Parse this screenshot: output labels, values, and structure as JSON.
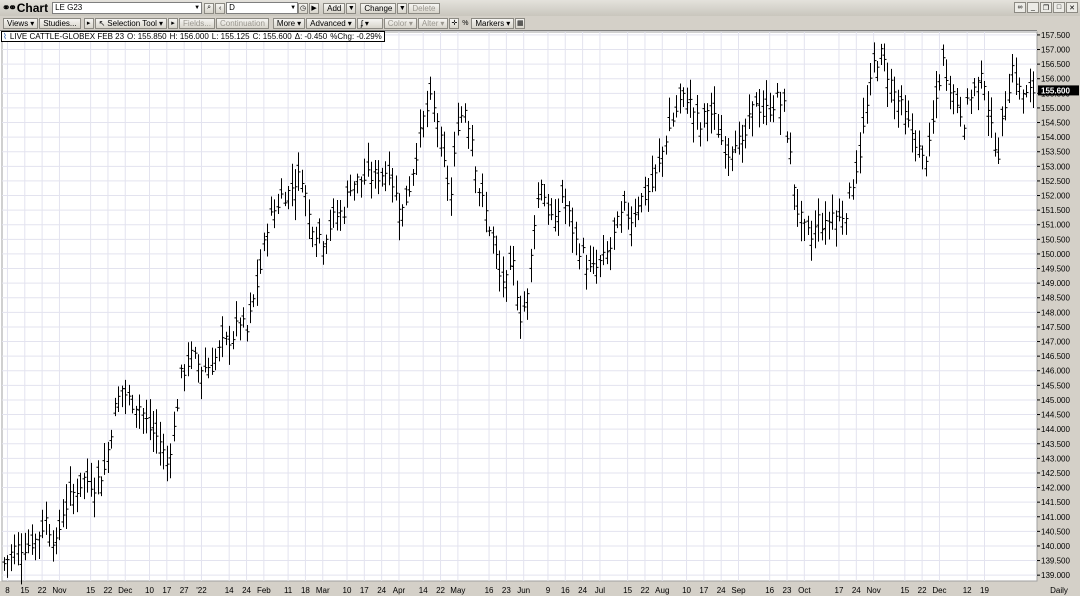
{
  "window": {
    "title": "Chart",
    "symbol": "LE G23",
    "interval": "D",
    "add_label": "Add",
    "change_label": "Change",
    "delete_label": "Delete"
  },
  "toolbar": {
    "views": "Views",
    "studies": "Studies...",
    "selection_tool": "Selection Tool",
    "fields": "Fields...",
    "continuation": "Continuation",
    "more": "More",
    "advanced": "Advanced",
    "color": "Color",
    "alter": "Alter",
    "percent": "%",
    "markers": "Markers"
  },
  "info": {
    "instrument": "LIVE CATTLE-GLOBEX FEB 23",
    "open": "O: 155.850",
    "high": "H: 156.000",
    "low": "L: 155.125",
    "close": "C: 155.600",
    "change": "Δ: -0.450",
    "pct_change": "%Chg: -0.29%"
  },
  "colors": {
    "bars": "#000000",
    "grid": "#e3e3ef",
    "background": "#ffffff",
    "frame": "#d4d0c8",
    "last_price_bg": "#000000"
  },
  "chart_data": {
    "type": "ohlc",
    "ylim": [
      138.8,
      157.6
    ],
    "yticks": [
      "157.500",
      "157.000",
      "156.500",
      "156.000",
      "155.500",
      "155.000",
      "154.500",
      "154.000",
      "153.500",
      "153.000",
      "152.500",
      "152.000",
      "151.500",
      "151.000",
      "150.500",
      "150.000",
      "149.500",
      "149.000",
      "148.500",
      "148.000",
      "147.500",
      "147.000",
      "146.500",
      "146.000",
      "145.500",
      "145.000",
      "144.500",
      "144.000",
      "143.500",
      "143.000",
      "142.500",
      "142.000",
      "141.500",
      "141.000",
      "140.500",
      "140.000",
      "139.500",
      "139.000"
    ],
    "last_price": "155.600",
    "interval_label": "Daily",
    "xlabels": [
      {
        "label": "8",
        "i": 1
      },
      {
        "label": "15",
        "i": 6
      },
      {
        "label": "22",
        "i": 11
      },
      {
        "label": "Nov",
        "i": 16
      },
      {
        "label": "15",
        "i": 25
      },
      {
        "label": "22",
        "i": 30
      },
      {
        "label": "Dec",
        "i": 35
      },
      {
        "label": "10",
        "i": 42
      },
      {
        "label": "17",
        "i": 47
      },
      {
        "label": "27",
        "i": 52
      },
      {
        "label": "'22",
        "i": 57
      },
      {
        "label": "14",
        "i": 65
      },
      {
        "label": "24",
        "i": 70
      },
      {
        "label": "Feb",
        "i": 75
      },
      {
        "label": "11",
        "i": 82
      },
      {
        "label": "18",
        "i": 87
      },
      {
        "label": "Mar",
        "i": 92
      },
      {
        "label": "10",
        "i": 99
      },
      {
        "label": "17",
        "i": 104
      },
      {
        "label": "24",
        "i": 109
      },
      {
        "label": "Apr",
        "i": 114
      },
      {
        "label": "14",
        "i": 121
      },
      {
        "label": "22",
        "i": 126
      },
      {
        "label": "May",
        "i": 131
      },
      {
        "label": "16",
        "i": 140
      },
      {
        "label": "23",
        "i": 145
      },
      {
        "label": "Jun",
        "i": 150
      },
      {
        "label": "9",
        "i": 157
      },
      {
        "label": "16",
        "i": 162
      },
      {
        "label": "24",
        "i": 167
      },
      {
        "label": "Jul",
        "i": 172
      },
      {
        "label": "15",
        "i": 180
      },
      {
        "label": "22",
        "i": 185
      },
      {
        "label": "Aug",
        "i": 190
      },
      {
        "label": "10",
        "i": 197
      },
      {
        "label": "17",
        "i": 202
      },
      {
        "label": "24",
        "i": 207
      },
      {
        "label": "Sep",
        "i": 212
      },
      {
        "label": "16",
        "i": 221
      },
      {
        "label": "23",
        "i": 226
      },
      {
        "label": "Oct",
        "i": 231
      },
      {
        "label": "17",
        "i": 241
      },
      {
        "label": "24",
        "i": 246
      },
      {
        "label": "Nov",
        "i": 251
      },
      {
        "label": "15",
        "i": 260
      },
      {
        "label": "22",
        "i": 265
      },
      {
        "label": "Dec",
        "i": 270
      },
      {
        "label": "12",
        "i": 278
      },
      {
        "label": "19",
        "i": 283
      }
    ],
    "anchors": [
      [
        0,
        139.4
      ],
      [
        3,
        139.9
      ],
      [
        6,
        140.0
      ],
      [
        9,
        140.2
      ],
      [
        12,
        140.9
      ],
      [
        15,
        140.0
      ],
      [
        17,
        141.2
      ],
      [
        20,
        141.8
      ],
      [
        23,
        142.3
      ],
      [
        26,
        142.1
      ],
      [
        29,
        142.6
      ],
      [
        32,
        144.7
      ],
      [
        34,
        145.4
      ],
      [
        36,
        145.0
      ],
      [
        39,
        144.8
      ],
      [
        42,
        144.0
      ],
      [
        45,
        143.6
      ],
      [
        47,
        142.8
      ],
      [
        49,
        144.0
      ],
      [
        51,
        145.8
      ],
      [
        54,
        146.5
      ],
      [
        57,
        146.1
      ],
      [
        60,
        146.2
      ],
      [
        63,
        146.9
      ],
      [
        66,
        147.2
      ],
      [
        68,
        147.7
      ],
      [
        70,
        147.3
      ],
      [
        72,
        148.4
      ],
      [
        74,
        149.5
      ],
      [
        76,
        151.0
      ],
      [
        78,
        151.5
      ],
      [
        80,
        152.0
      ],
      [
        82,
        152.1
      ],
      [
        84,
        152.5
      ],
      [
        86,
        152.7
      ],
      [
        88,
        151.3
      ],
      [
        90,
        150.8
      ],
      [
        92,
        150.5
      ],
      [
        95,
        151.2
      ],
      [
        98,
        151.5
      ],
      [
        100,
        152.4
      ],
      [
        102,
        152.5
      ],
      [
        105,
        152.6
      ],
      [
        108,
        152.7
      ],
      [
        111,
        152.9
      ],
      [
        113,
        152.0
      ],
      [
        115,
        151.5
      ],
      [
        117,
        152.3
      ],
      [
        119,
        153.5
      ],
      [
        121,
        154.6
      ],
      [
        123,
        155.2
      ],
      [
        125,
        154.6
      ],
      [
        127,
        153.0
      ],
      [
        129,
        152.0
      ],
      [
        131,
        154.5
      ],
      [
        133,
        155.0
      ],
      [
        135,
        154.0
      ],
      [
        137,
        152.2
      ],
      [
        139,
        151.4
      ],
      [
        141,
        150.5
      ],
      [
        143,
        149.2
      ],
      [
        145,
        149.0
      ],
      [
        147,
        149.6
      ],
      [
        149,
        147.9
      ],
      [
        151,
        148.5
      ],
      [
        153,
        151.2
      ],
      [
        155,
        152.5
      ],
      [
        157,
        151.5
      ],
      [
        159,
        151.0
      ],
      [
        161,
        152.0
      ],
      [
        163,
        151.3
      ],
      [
        165,
        150.4
      ],
      [
        167,
        150.0
      ],
      [
        169,
        149.4
      ],
      [
        171,
        149.5
      ],
      [
        173,
        149.8
      ],
      [
        175,
        150.2
      ],
      [
        177,
        151.0
      ],
      [
        179,
        151.5
      ],
      [
        181,
        151.2
      ],
      [
        183,
        151.8
      ],
      [
        185,
        152.0
      ],
      [
        187,
        152.3
      ],
      [
        189,
        153.0
      ],
      [
        191,
        154.0
      ],
      [
        193,
        154.6
      ],
      [
        195,
        155.2
      ],
      [
        197,
        155.4
      ],
      [
        199,
        154.9
      ],
      [
        201,
        154.3
      ],
      [
        203,
        155.0
      ],
      [
        205,
        154.6
      ],
      [
        207,
        153.9
      ],
      [
        209,
        153.5
      ],
      [
        211,
        154.0
      ],
      [
        213,
        153.6
      ],
      [
        215,
        154.5
      ],
      [
        217,
        155.3
      ],
      [
        219,
        154.8
      ],
      [
        221,
        155.0
      ],
      [
        223,
        155.3
      ],
      [
        225,
        155.0
      ],
      [
        227,
        153.3
      ],
      [
        229,
        151.5
      ],
      [
        231,
        150.8
      ],
      [
        233,
        150.5
      ],
      [
        235,
        151.2
      ],
      [
        237,
        150.9
      ],
      [
        239,
        151.4
      ],
      [
        241,
        151.2
      ],
      [
        243,
        151.5
      ],
      [
        245,
        152.5
      ],
      [
        247,
        153.5
      ],
      [
        249,
        155.0
      ],
      [
        251,
        156.5
      ],
      [
        253,
        156.8
      ],
      [
        255,
        156.2
      ],
      [
        257,
        155.5
      ],
      [
        259,
        155.0
      ],
      [
        261,
        154.4
      ],
      [
        263,
        153.9
      ],
      [
        265,
        153.2
      ],
      [
        267,
        153.6
      ],
      [
        269,
        155.3
      ],
      [
        271,
        156.6
      ],
      [
        273,
        155.8
      ],
      [
        275,
        155.2
      ],
      [
        277,
        154.6
      ],
      [
        279,
        155.5
      ],
      [
        281,
        155.8
      ],
      [
        283,
        156.0
      ],
      [
        285,
        154.2
      ],
      [
        287,
        153.5
      ],
      [
        289,
        155.2
      ],
      [
        291,
        156.4
      ],
      [
        293,
        155.6
      ],
      [
        295,
        155.4
      ],
      [
        297,
        155.6
      ]
    ]
  }
}
